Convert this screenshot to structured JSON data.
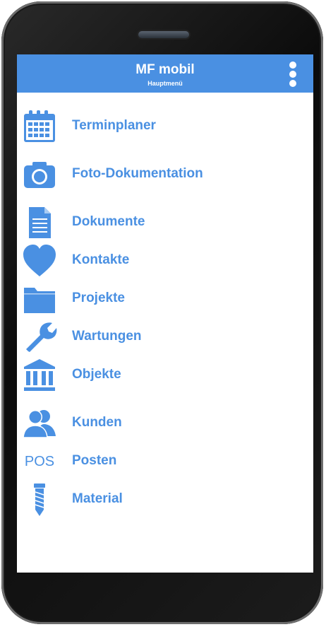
{
  "header": {
    "title": "MF mobil",
    "subtitle": "Hauptmenü",
    "background_color": "#4a90e2"
  },
  "menu": {
    "accent_color": "#4a90e2",
    "items": [
      {
        "label": "Terminplaner",
        "icon": "calendar-icon"
      },
      {
        "label": "Foto-Dokumentation",
        "icon": "camera-icon"
      },
      {
        "label": "Dokumente",
        "icon": "document-icon"
      },
      {
        "label": "Kontakte",
        "icon": "heart-icon"
      },
      {
        "label": "Projekte",
        "icon": "folder-icon"
      },
      {
        "label": "Wartungen",
        "icon": "wrench-icon"
      },
      {
        "label": "Objekte",
        "icon": "building-icon"
      },
      {
        "label": "Kunden",
        "icon": "users-icon"
      },
      {
        "label": "Posten",
        "icon": "pos-icon",
        "icon_text": "POS"
      },
      {
        "label": "Material",
        "icon": "screw-icon"
      }
    ]
  }
}
